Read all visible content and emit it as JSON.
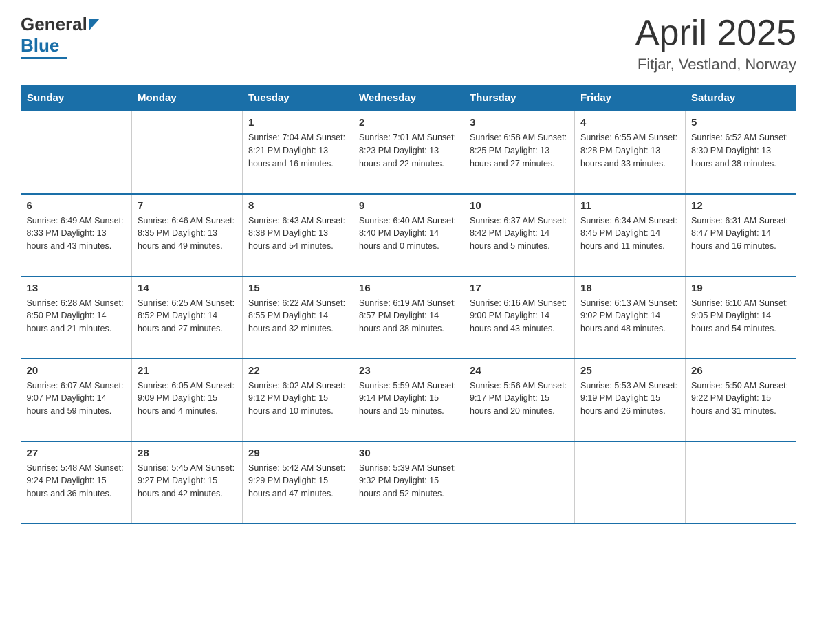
{
  "header": {
    "logo_general": "General",
    "logo_blue": "Blue",
    "title": "April 2025",
    "subtitle": "Fitjar, Vestland, Norway"
  },
  "days_of_week": [
    "Sunday",
    "Monday",
    "Tuesday",
    "Wednesday",
    "Thursday",
    "Friday",
    "Saturday"
  ],
  "weeks": [
    [
      {
        "day": "",
        "info": ""
      },
      {
        "day": "",
        "info": ""
      },
      {
        "day": "1",
        "info": "Sunrise: 7:04 AM\nSunset: 8:21 PM\nDaylight: 13 hours\nand 16 minutes."
      },
      {
        "day": "2",
        "info": "Sunrise: 7:01 AM\nSunset: 8:23 PM\nDaylight: 13 hours\nand 22 minutes."
      },
      {
        "day": "3",
        "info": "Sunrise: 6:58 AM\nSunset: 8:25 PM\nDaylight: 13 hours\nand 27 minutes."
      },
      {
        "day": "4",
        "info": "Sunrise: 6:55 AM\nSunset: 8:28 PM\nDaylight: 13 hours\nand 33 minutes."
      },
      {
        "day": "5",
        "info": "Sunrise: 6:52 AM\nSunset: 8:30 PM\nDaylight: 13 hours\nand 38 minutes."
      }
    ],
    [
      {
        "day": "6",
        "info": "Sunrise: 6:49 AM\nSunset: 8:33 PM\nDaylight: 13 hours\nand 43 minutes."
      },
      {
        "day": "7",
        "info": "Sunrise: 6:46 AM\nSunset: 8:35 PM\nDaylight: 13 hours\nand 49 minutes."
      },
      {
        "day": "8",
        "info": "Sunrise: 6:43 AM\nSunset: 8:38 PM\nDaylight: 13 hours\nand 54 minutes."
      },
      {
        "day": "9",
        "info": "Sunrise: 6:40 AM\nSunset: 8:40 PM\nDaylight: 14 hours\nand 0 minutes."
      },
      {
        "day": "10",
        "info": "Sunrise: 6:37 AM\nSunset: 8:42 PM\nDaylight: 14 hours\nand 5 minutes."
      },
      {
        "day": "11",
        "info": "Sunrise: 6:34 AM\nSunset: 8:45 PM\nDaylight: 14 hours\nand 11 minutes."
      },
      {
        "day": "12",
        "info": "Sunrise: 6:31 AM\nSunset: 8:47 PM\nDaylight: 14 hours\nand 16 minutes."
      }
    ],
    [
      {
        "day": "13",
        "info": "Sunrise: 6:28 AM\nSunset: 8:50 PM\nDaylight: 14 hours\nand 21 minutes."
      },
      {
        "day": "14",
        "info": "Sunrise: 6:25 AM\nSunset: 8:52 PM\nDaylight: 14 hours\nand 27 minutes."
      },
      {
        "day": "15",
        "info": "Sunrise: 6:22 AM\nSunset: 8:55 PM\nDaylight: 14 hours\nand 32 minutes."
      },
      {
        "day": "16",
        "info": "Sunrise: 6:19 AM\nSunset: 8:57 PM\nDaylight: 14 hours\nand 38 minutes."
      },
      {
        "day": "17",
        "info": "Sunrise: 6:16 AM\nSunset: 9:00 PM\nDaylight: 14 hours\nand 43 minutes."
      },
      {
        "day": "18",
        "info": "Sunrise: 6:13 AM\nSunset: 9:02 PM\nDaylight: 14 hours\nand 48 minutes."
      },
      {
        "day": "19",
        "info": "Sunrise: 6:10 AM\nSunset: 9:05 PM\nDaylight: 14 hours\nand 54 minutes."
      }
    ],
    [
      {
        "day": "20",
        "info": "Sunrise: 6:07 AM\nSunset: 9:07 PM\nDaylight: 14 hours\nand 59 minutes."
      },
      {
        "day": "21",
        "info": "Sunrise: 6:05 AM\nSunset: 9:09 PM\nDaylight: 15 hours\nand 4 minutes."
      },
      {
        "day": "22",
        "info": "Sunrise: 6:02 AM\nSunset: 9:12 PM\nDaylight: 15 hours\nand 10 minutes."
      },
      {
        "day": "23",
        "info": "Sunrise: 5:59 AM\nSunset: 9:14 PM\nDaylight: 15 hours\nand 15 minutes."
      },
      {
        "day": "24",
        "info": "Sunrise: 5:56 AM\nSunset: 9:17 PM\nDaylight: 15 hours\nand 20 minutes."
      },
      {
        "day": "25",
        "info": "Sunrise: 5:53 AM\nSunset: 9:19 PM\nDaylight: 15 hours\nand 26 minutes."
      },
      {
        "day": "26",
        "info": "Sunrise: 5:50 AM\nSunset: 9:22 PM\nDaylight: 15 hours\nand 31 minutes."
      }
    ],
    [
      {
        "day": "27",
        "info": "Sunrise: 5:48 AM\nSunset: 9:24 PM\nDaylight: 15 hours\nand 36 minutes."
      },
      {
        "day": "28",
        "info": "Sunrise: 5:45 AM\nSunset: 9:27 PM\nDaylight: 15 hours\nand 42 minutes."
      },
      {
        "day": "29",
        "info": "Sunrise: 5:42 AM\nSunset: 9:29 PM\nDaylight: 15 hours\nand 47 minutes."
      },
      {
        "day": "30",
        "info": "Sunrise: 5:39 AM\nSunset: 9:32 PM\nDaylight: 15 hours\nand 52 minutes."
      },
      {
        "day": "",
        "info": ""
      },
      {
        "day": "",
        "info": ""
      },
      {
        "day": "",
        "info": ""
      }
    ]
  ]
}
